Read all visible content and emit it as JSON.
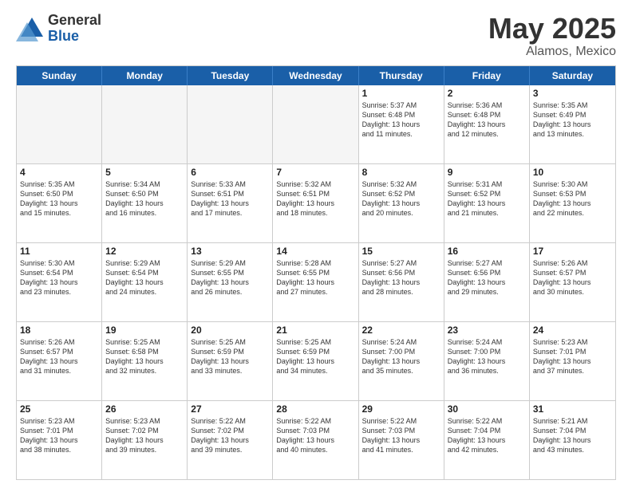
{
  "logo": {
    "general": "General",
    "blue": "Blue"
  },
  "title": "May 2025",
  "location": "Alamos, Mexico",
  "days": [
    "Sunday",
    "Monday",
    "Tuesday",
    "Wednesday",
    "Thursday",
    "Friday",
    "Saturday"
  ],
  "rows": [
    [
      {
        "day": "",
        "text": "",
        "empty": true
      },
      {
        "day": "",
        "text": "",
        "empty": true
      },
      {
        "day": "",
        "text": "",
        "empty": true
      },
      {
        "day": "",
        "text": "",
        "empty": true
      },
      {
        "day": "1",
        "text": "Sunrise: 5:37 AM\nSunset: 6:48 PM\nDaylight: 13 hours\nand 11 minutes."
      },
      {
        "day": "2",
        "text": "Sunrise: 5:36 AM\nSunset: 6:48 PM\nDaylight: 13 hours\nand 12 minutes."
      },
      {
        "day": "3",
        "text": "Sunrise: 5:35 AM\nSunset: 6:49 PM\nDaylight: 13 hours\nand 13 minutes."
      }
    ],
    [
      {
        "day": "4",
        "text": "Sunrise: 5:35 AM\nSunset: 6:50 PM\nDaylight: 13 hours\nand 15 minutes."
      },
      {
        "day": "5",
        "text": "Sunrise: 5:34 AM\nSunset: 6:50 PM\nDaylight: 13 hours\nand 16 minutes."
      },
      {
        "day": "6",
        "text": "Sunrise: 5:33 AM\nSunset: 6:51 PM\nDaylight: 13 hours\nand 17 minutes."
      },
      {
        "day": "7",
        "text": "Sunrise: 5:32 AM\nSunset: 6:51 PM\nDaylight: 13 hours\nand 18 minutes."
      },
      {
        "day": "8",
        "text": "Sunrise: 5:32 AM\nSunset: 6:52 PM\nDaylight: 13 hours\nand 20 minutes."
      },
      {
        "day": "9",
        "text": "Sunrise: 5:31 AM\nSunset: 6:52 PM\nDaylight: 13 hours\nand 21 minutes."
      },
      {
        "day": "10",
        "text": "Sunrise: 5:30 AM\nSunset: 6:53 PM\nDaylight: 13 hours\nand 22 minutes."
      }
    ],
    [
      {
        "day": "11",
        "text": "Sunrise: 5:30 AM\nSunset: 6:54 PM\nDaylight: 13 hours\nand 23 minutes."
      },
      {
        "day": "12",
        "text": "Sunrise: 5:29 AM\nSunset: 6:54 PM\nDaylight: 13 hours\nand 24 minutes."
      },
      {
        "day": "13",
        "text": "Sunrise: 5:29 AM\nSunset: 6:55 PM\nDaylight: 13 hours\nand 26 minutes."
      },
      {
        "day": "14",
        "text": "Sunrise: 5:28 AM\nSunset: 6:55 PM\nDaylight: 13 hours\nand 27 minutes."
      },
      {
        "day": "15",
        "text": "Sunrise: 5:27 AM\nSunset: 6:56 PM\nDaylight: 13 hours\nand 28 minutes."
      },
      {
        "day": "16",
        "text": "Sunrise: 5:27 AM\nSunset: 6:56 PM\nDaylight: 13 hours\nand 29 minutes."
      },
      {
        "day": "17",
        "text": "Sunrise: 5:26 AM\nSunset: 6:57 PM\nDaylight: 13 hours\nand 30 minutes."
      }
    ],
    [
      {
        "day": "18",
        "text": "Sunrise: 5:26 AM\nSunset: 6:57 PM\nDaylight: 13 hours\nand 31 minutes."
      },
      {
        "day": "19",
        "text": "Sunrise: 5:25 AM\nSunset: 6:58 PM\nDaylight: 13 hours\nand 32 minutes."
      },
      {
        "day": "20",
        "text": "Sunrise: 5:25 AM\nSunset: 6:59 PM\nDaylight: 13 hours\nand 33 minutes."
      },
      {
        "day": "21",
        "text": "Sunrise: 5:25 AM\nSunset: 6:59 PM\nDaylight: 13 hours\nand 34 minutes."
      },
      {
        "day": "22",
        "text": "Sunrise: 5:24 AM\nSunset: 7:00 PM\nDaylight: 13 hours\nand 35 minutes."
      },
      {
        "day": "23",
        "text": "Sunrise: 5:24 AM\nSunset: 7:00 PM\nDaylight: 13 hours\nand 36 minutes."
      },
      {
        "day": "24",
        "text": "Sunrise: 5:23 AM\nSunset: 7:01 PM\nDaylight: 13 hours\nand 37 minutes."
      }
    ],
    [
      {
        "day": "25",
        "text": "Sunrise: 5:23 AM\nSunset: 7:01 PM\nDaylight: 13 hours\nand 38 minutes."
      },
      {
        "day": "26",
        "text": "Sunrise: 5:23 AM\nSunset: 7:02 PM\nDaylight: 13 hours\nand 39 minutes."
      },
      {
        "day": "27",
        "text": "Sunrise: 5:22 AM\nSunset: 7:02 PM\nDaylight: 13 hours\nand 39 minutes."
      },
      {
        "day": "28",
        "text": "Sunrise: 5:22 AM\nSunset: 7:03 PM\nDaylight: 13 hours\nand 40 minutes."
      },
      {
        "day": "29",
        "text": "Sunrise: 5:22 AM\nSunset: 7:03 PM\nDaylight: 13 hours\nand 41 minutes."
      },
      {
        "day": "30",
        "text": "Sunrise: 5:22 AM\nSunset: 7:04 PM\nDaylight: 13 hours\nand 42 minutes."
      },
      {
        "day": "31",
        "text": "Sunrise: 5:21 AM\nSunset: 7:04 PM\nDaylight: 13 hours\nand 43 minutes."
      }
    ]
  ]
}
